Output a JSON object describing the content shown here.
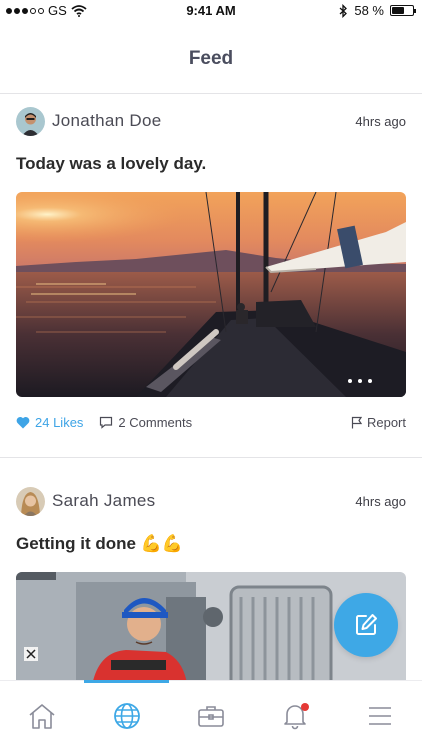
{
  "status_bar": {
    "carrier": "GS",
    "time": "9:41 AM",
    "battery": "58 %",
    "battery_level": 0.58
  },
  "header": {
    "title": "Feed"
  },
  "posts": [
    {
      "author": "Jonathan Doe",
      "time": "4hrs ago",
      "text": "Today was a lovely day.",
      "likes_label": "24 Likes",
      "comments_label": "2 Comments",
      "report_label": "Report",
      "image_subject": "sailboat at sunset"
    },
    {
      "author": "Sarah James",
      "time": "4hrs ago",
      "text": "Getting it done 💪💪",
      "image_subject": "woman in hard hat on ship deck"
    }
  ],
  "tabs": [
    {
      "icon": "home-icon"
    },
    {
      "icon": "globe-icon",
      "active": true
    },
    {
      "icon": "briefcase-icon"
    },
    {
      "icon": "bell-icon",
      "badge": true
    },
    {
      "icon": "menu-icon"
    }
  ],
  "colors": {
    "accent": "#3ea8e6",
    "like": "#3ea4e6",
    "badge": "#e53935",
    "title": "#4a4d5e"
  }
}
